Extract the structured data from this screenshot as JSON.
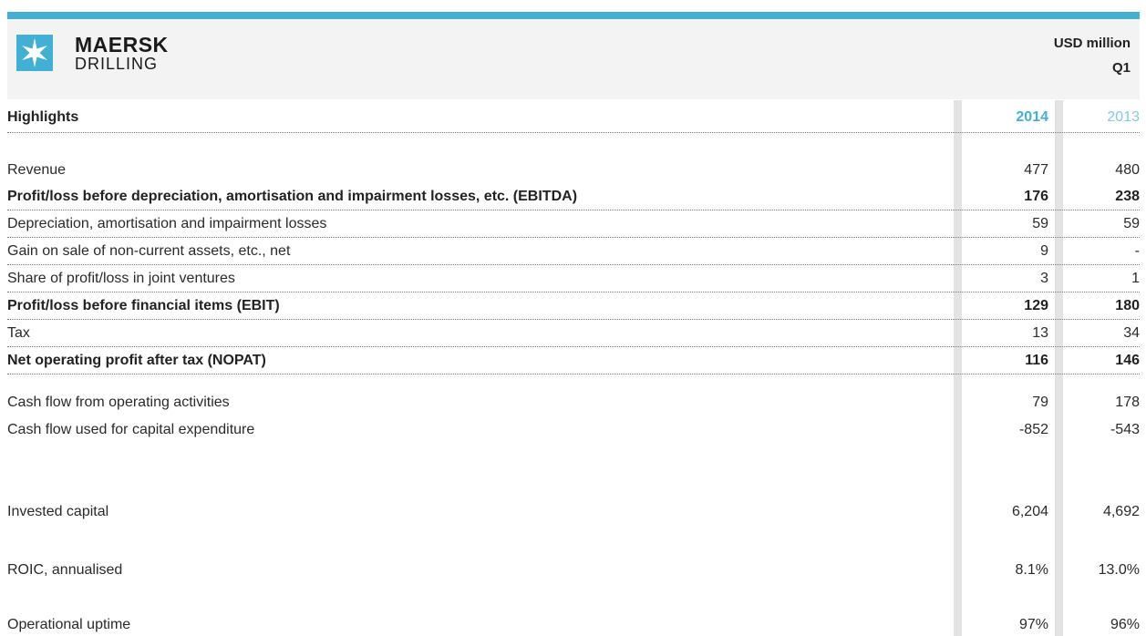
{
  "brand": {
    "line1": "MAERSK",
    "line2": "DRILLING",
    "accent": "#42b0d5"
  },
  "header": {
    "unit": "USD million",
    "period": "Q1"
  },
  "highlights": {
    "title": "Highlights",
    "year1": "2014",
    "year2": "2013"
  },
  "rows": [
    {
      "label": "Revenue",
      "v1": "477",
      "v2": "480"
    },
    {
      "label": "Profit/loss before depreciation, amortisation and impairment losses, etc. (EBITDA)",
      "v1": "176",
      "v2": "238"
    },
    {
      "label": "Depreciation, amortisation and impairment losses",
      "v1": "59",
      "v2": "59"
    },
    {
      "label": "Gain on sale of non-current assets, etc., net",
      "v1": "9",
      "v2": "-"
    },
    {
      "label": "Share of profit/loss in joint ventures",
      "v1": "3",
      "v2": "1"
    },
    {
      "label": "Profit/loss before financial items (EBIT)",
      "v1": "129",
      "v2": "180"
    },
    {
      "label": "Tax",
      "v1": "13",
      "v2": "34"
    },
    {
      "label": "Net operating profit after tax (NOPAT)",
      "v1": "116",
      "v2": "146"
    },
    {
      "label": "Cash flow from operating activities",
      "v1": "79",
      "v2": "178"
    },
    {
      "label": "Cash flow used for capital expenditure",
      "v1": "-852",
      "v2": "-543"
    },
    {
      "label": "Invested capital",
      "v1": "6,204",
      "v2": "4,692"
    },
    {
      "label": "ROIC, annualised",
      "v1": "8.1%",
      "v2": "13.0%"
    },
    {
      "label": "Operational uptime",
      "v1": "97%",
      "v2": "96%"
    }
  ]
}
